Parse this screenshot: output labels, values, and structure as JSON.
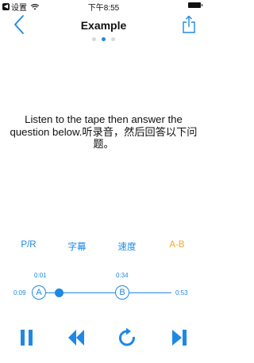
{
  "status_bar": {
    "back_app": "设置",
    "time": "下午8:55"
  },
  "nav": {
    "title": "Example",
    "back_icon": "chevron-left-icon",
    "share_icon": "share-icon"
  },
  "pager": {
    "count": 3,
    "active_index": 1
  },
  "question": {
    "text": "Listen to the tape then answer the question below.听录音，然后回答以下问题。"
  },
  "tools": {
    "pr_label": "P/R",
    "subtitle_label": "字幕",
    "speed_label": "速度",
    "ab_label": "A-B"
  },
  "player": {
    "current_time": "0:09",
    "total_time": "0:53",
    "marker_a": {
      "label": "A",
      "time": "0:01"
    },
    "marker_b": {
      "label": "B",
      "time": "0:34"
    },
    "progress_fraction": 0.17
  },
  "colors": {
    "accent": "#1e88e5",
    "ab_accent": "#f5a623",
    "text": "#111111"
  },
  "controls": {
    "pause_icon": "pause-icon",
    "rewind_icon": "rewind-icon",
    "replay_icon": "replay-icon",
    "next_icon": "skip-next-icon"
  }
}
